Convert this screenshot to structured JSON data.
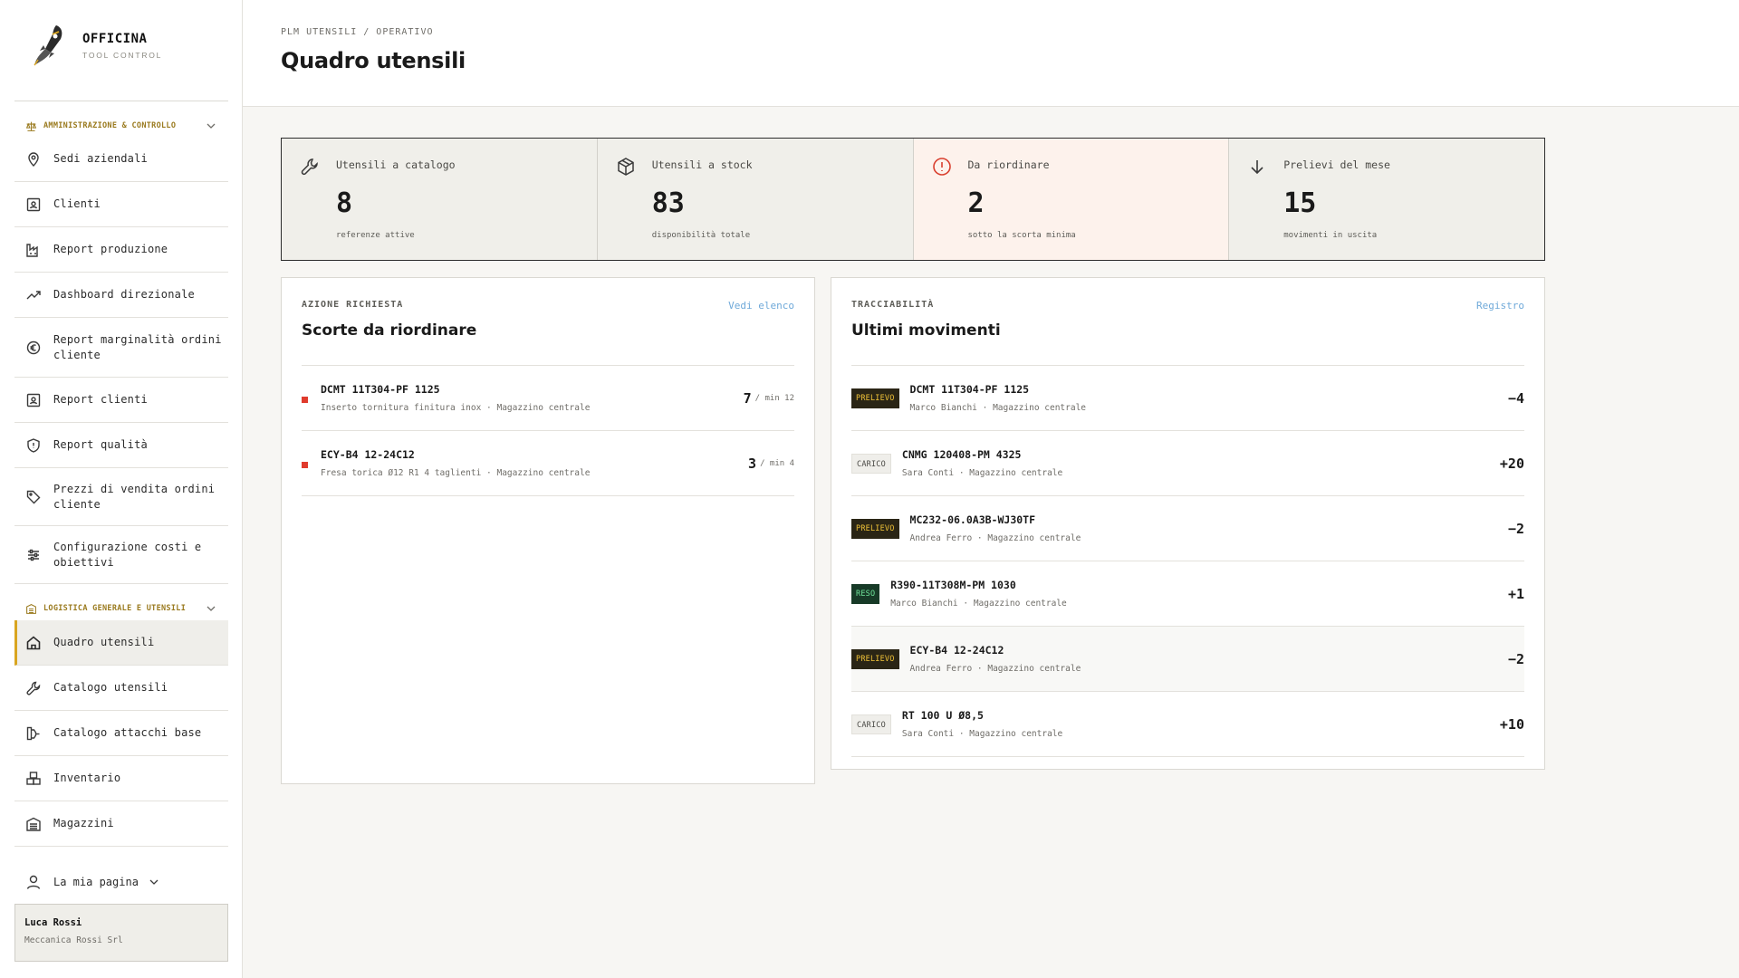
{
  "brand": {
    "title": "OFFICINA",
    "subtitle": "TOOL CONTROL"
  },
  "sidebar": {
    "sections": [
      {
        "label": "AMMINISTRAZIONE & CONTROLLO",
        "items": [
          {
            "label": "Sedi aziendali",
            "icon": "map-pin-icon"
          },
          {
            "label": "Clienti",
            "icon": "contact-card-icon"
          },
          {
            "label": "Report produzione",
            "icon": "factory-icon"
          },
          {
            "label": "Dashboard direzionale",
            "icon": "trend-up-icon"
          },
          {
            "label": "Report marginalità ordini cliente",
            "icon": "euro-icon"
          },
          {
            "label": "Report clienti",
            "icon": "contact-card-icon"
          },
          {
            "label": "Report qualità",
            "icon": "shield-icon"
          },
          {
            "label": "Prezzi di vendita ordini cliente",
            "icon": "tag-icon"
          },
          {
            "label": "Configurazione costi e obiettivi",
            "icon": "sliders-icon"
          }
        ]
      },
      {
        "label": "LOGISTICA GENERALE E UTENSILI",
        "items": [
          {
            "label": "Quadro utensili",
            "icon": "home-icon",
            "active": true
          },
          {
            "label": "Catalogo utensili",
            "icon": "wrench-icon"
          },
          {
            "label": "Catalogo attacchi base",
            "icon": "tool-holder-icon"
          },
          {
            "label": "Inventario",
            "icon": "boxes-icon"
          },
          {
            "label": "Magazzini",
            "icon": "warehouse-icon"
          }
        ]
      }
    ],
    "user_menu": {
      "label": "La mia pagina"
    },
    "user": {
      "name": "Luca Rossi",
      "company": "Meccanica Rossi Srl"
    }
  },
  "header": {
    "breadcrumb": "PLM UTENSILI / OPERATIVO",
    "title": "Quadro utensili"
  },
  "kpis": [
    {
      "label": "Utensili a catalogo",
      "value": "8",
      "sub": "referenze attive",
      "icon": "wrench-icon"
    },
    {
      "label": "Utensili a stock",
      "value": "83",
      "sub": "disponibilità totale",
      "icon": "package-icon"
    },
    {
      "label": "Da riordinare",
      "value": "2",
      "sub": "sotto la scorta minima",
      "icon": "alert-circle-icon",
      "alert": true
    },
    {
      "label": "Prelievi del mese",
      "value": "15",
      "sub": "movimenti in uscita",
      "icon": "arrow-down-icon"
    }
  ],
  "reorder": {
    "eyebrow": "AZIONE RICHIESTA",
    "title": "Scorte da riordinare",
    "link": "Vedi elenco",
    "rows": [
      {
        "code": "DCMT 11T304-PF 1125",
        "desc": "Inserto tornitura finitura inox",
        "location": "Magazzino centrale",
        "qty": "7",
        "min": "/ min 12"
      },
      {
        "code": "ECY-B4 12-24C12",
        "desc": "Fresa torica Ø12 R1 4 taglienti",
        "location": "Magazzino centrale",
        "qty": "3",
        "min": "/ min 4"
      }
    ]
  },
  "movements": {
    "eyebrow": "TRACCIABILITÀ",
    "title": "Ultimi movimenti",
    "link": "Registro",
    "rows": [
      {
        "type": "PRELIEVO",
        "kind": "prelievo",
        "code": "DCMT 11T304-PF 1125",
        "user": "Marco Bianchi",
        "location": "Magazzino centrale",
        "delta": "−4"
      },
      {
        "type": "CARICO",
        "kind": "carico",
        "code": "CNMG 120408-PM 4325",
        "user": "Sara Conti",
        "location": "Magazzino centrale",
        "delta": "+20"
      },
      {
        "type": "PRELIEVO",
        "kind": "prelievo",
        "code": "MC232-06.0A3B-WJ30TF",
        "user": "Andrea Ferro",
        "location": "Magazzino centrale",
        "delta": "−2"
      },
      {
        "type": "RESO",
        "kind": "reso",
        "code": "R390-11T308M-PM 1030",
        "user": "Marco Bianchi",
        "location": "Magazzino centrale",
        "delta": "+1"
      },
      {
        "type": "PRELIEVO",
        "kind": "prelievo",
        "code": "ECY-B4 12-24C12",
        "user": "Andrea Ferro",
        "location": "Magazzino centrale",
        "delta": "−2",
        "highlight": true
      },
      {
        "type": "CARICO",
        "kind": "carico",
        "code": "RT 100 U Ø8,5",
        "user": "Sara Conti",
        "location": "Magazzino centrale",
        "delta": "+10"
      }
    ]
  },
  "colors": {
    "accent": "#d9a520",
    "alert_dot": "#e03b2d",
    "link": "#6fa9d9"
  }
}
